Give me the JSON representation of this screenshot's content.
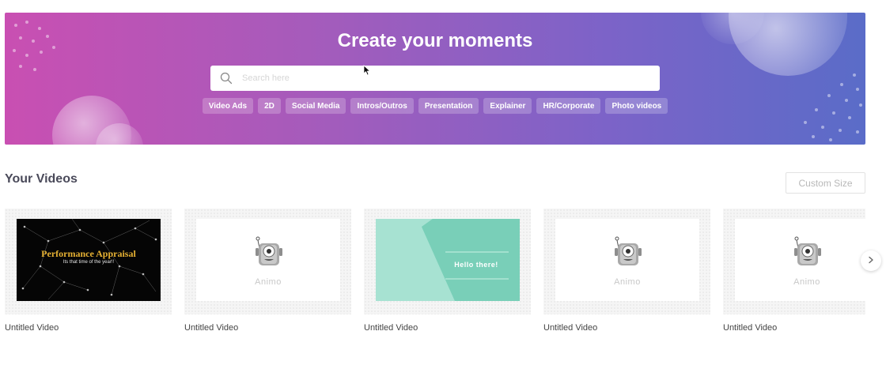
{
  "hero": {
    "title": "Create your moments",
    "search": {
      "placeholder": "Search here",
      "value": ""
    },
    "tags": [
      {
        "label": "Video Ads"
      },
      {
        "label": "2D"
      },
      {
        "label": "Social Media"
      },
      {
        "label": "Intros/Outros"
      },
      {
        "label": "Presentation"
      },
      {
        "label": "Explainer"
      },
      {
        "label": "HR/Corporate"
      },
      {
        "label": "Photo videos"
      }
    ]
  },
  "videos_section": {
    "title": "Your Videos",
    "custom_size_label": "Custom Size",
    "items": [
      {
        "title": "Untitled Video",
        "thumbnail": {
          "type": "performance",
          "heading": "Performance Appraisal",
          "subheading": "Its that time of the year!!"
        }
      },
      {
        "title": "Untitled Video",
        "thumbnail": {
          "type": "animo",
          "label": "Animo"
        }
      },
      {
        "title": "Untitled Video",
        "thumbnail": {
          "type": "hello",
          "label": "Hello there!"
        }
      },
      {
        "title": "Untitled Video",
        "thumbnail": {
          "type": "animo",
          "label": "Animo"
        }
      },
      {
        "title": "Untitled Video",
        "thumbnail": {
          "type": "animo",
          "label": "Animo"
        }
      }
    ]
  },
  "icons": {
    "search": "search-icon",
    "next": "chevron-right-icon",
    "cursor": "mouse-pointer-icon",
    "mascot": "animo-robot-icon"
  },
  "colors": {
    "hero_gradient_start": "#c94fb2",
    "hero_gradient_end": "#5a6cc8",
    "perf_gold": "#e6b133",
    "hello_teal": "#8fd8c4"
  }
}
